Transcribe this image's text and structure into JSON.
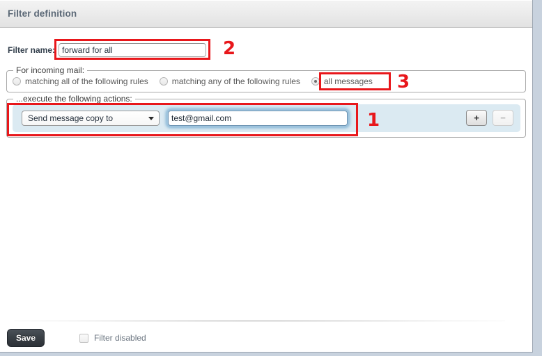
{
  "header": {
    "title": "Filter definition"
  },
  "filter_name": {
    "label": "Filter name:",
    "value": "forward for all",
    "placeholder": ""
  },
  "incoming": {
    "legend": "For incoming mail:",
    "options": [
      {
        "label": "matching all of the following rules",
        "selected": false
      },
      {
        "label": "matching any of the following rules",
        "selected": false
      },
      {
        "label": "all messages",
        "selected": true
      }
    ]
  },
  "actions": {
    "legend": "...execute the following actions:",
    "row": {
      "select_value": "Send message copy to",
      "select_options": [
        "Send message copy to"
      ],
      "input_value": "test@gmail.com",
      "input_placeholder": "",
      "add_label": "+",
      "remove_label": "−"
    }
  },
  "footer": {
    "save_label": "Save",
    "filter_disabled_label": "Filter disabled",
    "filter_disabled_checked": false
  },
  "annotations": [
    {
      "id": "1",
      "number": "1"
    },
    {
      "id": "2",
      "number": "2"
    },
    {
      "id": "3",
      "number": "3"
    }
  ],
  "colors": {
    "annotation_red": "#e8171b",
    "header_text": "#5b6876",
    "action_row_bg": "#dbeaf2",
    "focus_glow": "#9dc3dd",
    "save_button": "#3a4046"
  }
}
